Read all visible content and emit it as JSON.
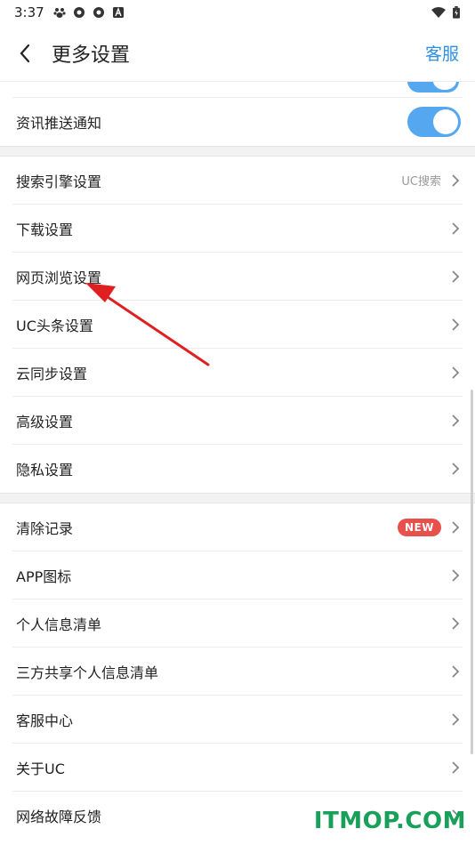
{
  "status_bar": {
    "time": "3:37",
    "left_icons": [
      "baidu-icon",
      "aperture-icon",
      "aperture-icon",
      "a-box-icon"
    ],
    "right_icons": [
      "wifi-icon",
      "battery-icon"
    ]
  },
  "header": {
    "title": "更多设置",
    "service_label": "客服",
    "accent_color": "#2f8fe6"
  },
  "groups": [
    {
      "items": [
        {
          "label": "资讯推送通知",
          "type": "toggle",
          "on": true
        }
      ]
    },
    {
      "items": [
        {
          "label": "搜索引擎设置",
          "value": "UC搜索"
        },
        {
          "label": "下载设置"
        },
        {
          "label": "网页浏览设置"
        },
        {
          "label": "UC头条设置"
        },
        {
          "label": "云同步设置"
        },
        {
          "label": "高级设置"
        },
        {
          "label": "隐私设置"
        }
      ]
    },
    {
      "items": [
        {
          "label": "清除记录",
          "badge": "NEW"
        },
        {
          "label": "APP图标"
        },
        {
          "label": "个人信息清单"
        },
        {
          "label": "三方共享个人信息清单"
        },
        {
          "label": "客服中心"
        },
        {
          "label": "关于UC"
        },
        {
          "label": "网络故障反馈"
        }
      ]
    }
  ],
  "annotation": {
    "arrow_color": "#e02020"
  },
  "watermark": "ITMOP.COM"
}
